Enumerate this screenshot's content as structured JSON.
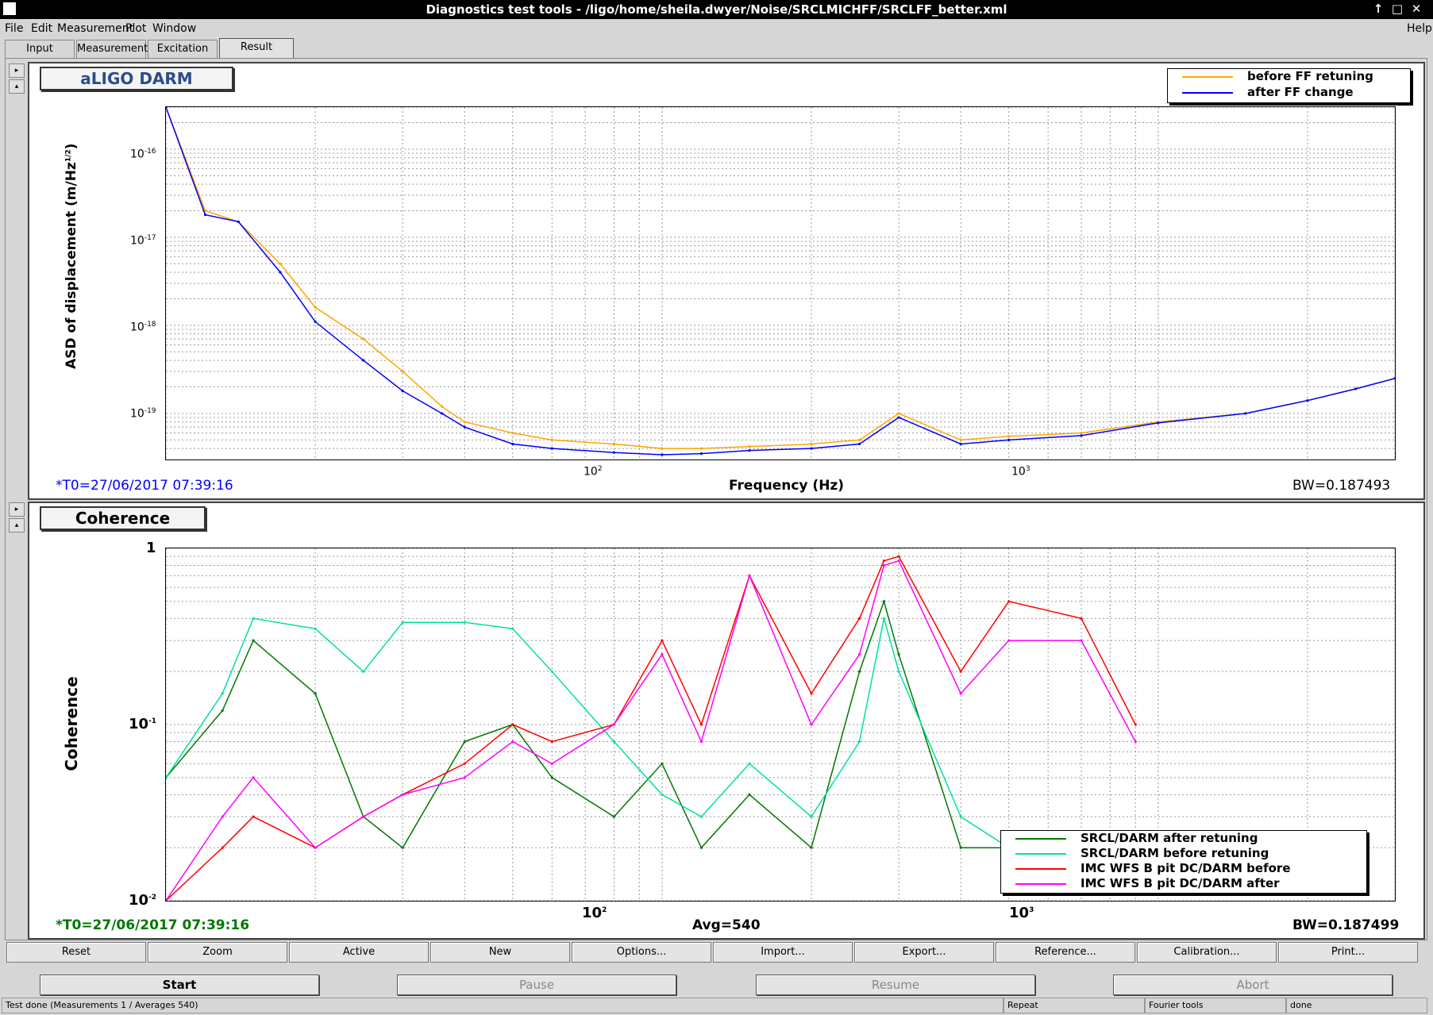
{
  "window": {
    "title": "Diagnostics test tools - /ligo/home/sheila.dwyer/Noise/SRCLMICHFF/SRCLFF_better.xml",
    "controls": [
      "↑",
      "□",
      "✕"
    ]
  },
  "menubar": {
    "items": [
      "File",
      "Edit",
      "Measurement",
      "Plot",
      "Window"
    ],
    "help": "Help"
  },
  "tabs": [
    {
      "label": "Input"
    },
    {
      "label": "Measurement"
    },
    {
      "label": "Excitation"
    },
    {
      "label": "Result"
    }
  ],
  "active_tab": "Result",
  "plot1": {
    "title": "aLIGO DARM",
    "ylabel": "ASD of displacement (m/Hz",
    "ylabel_sup": "1/2",
    "ylabel_close": ")",
    "xlabel": "Frequency (Hz)",
    "t0": "*T0=27/06/2017 07:39:16",
    "bw": "BW=0.187493",
    "y_ticks": [
      {
        "base": "10",
        "exp": "-16"
      },
      {
        "base": "10",
        "exp": "-17"
      },
      {
        "base": "10",
        "exp": "-18"
      },
      {
        "base": "10",
        "exp": "-19"
      }
    ],
    "x_ticks": [
      {
        "base": "10",
        "exp": "2"
      },
      {
        "base": "10",
        "exp": "3"
      }
    ],
    "legend": [
      {
        "label": "before FF retuning",
        "color": "#ffa500"
      },
      {
        "label": "after FF change",
        "color": "#0000ff"
      }
    ]
  },
  "plot2": {
    "title": "Coherence",
    "ylabel": "Coherence",
    "t0": "*T0=27/06/2017 07:39:16",
    "avg": "Avg=540",
    "bw": "BW=0.187499",
    "y_ticks": [
      {
        "base": "1",
        "exp": ""
      },
      {
        "base": "10",
        "exp": "-1"
      },
      {
        "base": "10",
        "exp": "-2"
      }
    ],
    "x_ticks": [
      {
        "base": "10",
        "exp": "2"
      },
      {
        "base": "10",
        "exp": "3"
      }
    ],
    "legend": [
      {
        "label": "SRCL/DARM after retuning",
        "color": "#007700"
      },
      {
        "label": "SRCL/DARM before retuning",
        "color": "#00e0a0"
      },
      {
        "label": "IMC WFS B pit DC/DARM before",
        "color": "#ff0000"
      },
      {
        "label": "IMC WFS B pit DC/DARM after",
        "color": "#ff00ff"
      }
    ]
  },
  "chart_data": [
    {
      "type": "line",
      "title": "aLIGO DARM",
      "xlabel": "Frequency (Hz)",
      "ylabel": "ASD of displacement (m/Hz^1/2)",
      "x_scale": "log",
      "y_scale": "log",
      "xlim": [
        10,
        3000
      ],
      "ylim": [
        3e-20,
        3e-16
      ],
      "grid": true,
      "legend_position": "top-right",
      "series": [
        {
          "name": "before FF retuning",
          "color": "#ffa500",
          "x": [
            10,
            12,
            14,
            17,
            20,
            25,
            30,
            36,
            40,
            50,
            60,
            80,
            100,
            120,
            150,
            200,
            250,
            300,
            400,
            500,
            700,
            1000,
            1500,
            2000,
            2500,
            3000
          ],
          "y": [
            3e-16,
            2e-17,
            1.5e-17,
            5e-18,
            1.6e-18,
            7e-19,
            3e-19,
            1.2e-19,
            8e-20,
            6e-20,
            5e-20,
            4.5e-20,
            4e-20,
            4e-20,
            4.2e-20,
            4.5e-20,
            5e-20,
            1e-19,
            5e-20,
            5.5e-20,
            6e-20,
            8e-20,
            1e-19,
            1.4e-19,
            1.9e-19,
            2.5e-19
          ]
        },
        {
          "name": "after FF change",
          "color": "#0000ff",
          "x": [
            10,
            12,
            14,
            17,
            20,
            25,
            30,
            36,
            40,
            50,
            60,
            80,
            100,
            120,
            150,
            200,
            250,
            300,
            400,
            500,
            700,
            1000,
            1500,
            2000,
            2500,
            3000
          ],
          "y": [
            3e-16,
            1.8e-17,
            1.5e-17,
            4e-18,
            1.1e-18,
            4e-19,
            1.8e-19,
            1e-19,
            7e-20,
            4.5e-20,
            4e-20,
            3.6e-20,
            3.4e-20,
            3.5e-20,
            3.8e-20,
            4e-20,
            4.5e-20,
            9e-20,
            4.5e-20,
            5e-20,
            5.6e-20,
            7.8e-20,
            1e-19,
            1.4e-19,
            1.9e-19,
            2.5e-19
          ]
        }
      ]
    },
    {
      "type": "line",
      "title": "Coherence",
      "ylabel": "Coherence",
      "x_scale": "log",
      "y_scale": "log",
      "xlim": [
        10,
        3000
      ],
      "ylim": [
        0.01,
        1
      ],
      "grid": true,
      "legend_position": "bottom-right",
      "series": [
        {
          "name": "SRCL/DARM after retuning",
          "color": "#007700",
          "x": [
            10,
            13,
            15,
            20,
            25,
            30,
            40,
            50,
            60,
            80,
            100,
            120,
            150,
            200,
            250,
            280,
            300,
            400,
            500,
            700,
            900
          ],
          "y": [
            0.05,
            0.12,
            0.3,
            0.15,
            0.03,
            0.02,
            0.08,
            0.1,
            0.05,
            0.03,
            0.06,
            0.02,
            0.04,
            0.02,
            0.2,
            0.5,
            0.25,
            0.02,
            0.02,
            0.02,
            0.015
          ]
        },
        {
          "name": "SRCL/DARM before retuning",
          "color": "#00e0a0",
          "x": [
            10,
            13,
            15,
            20,
            25,
            30,
            40,
            50,
            60,
            80,
            100,
            120,
            150,
            200,
            250,
            280,
            300,
            400,
            500,
            700,
            900
          ],
          "y": [
            0.05,
            0.15,
            0.4,
            0.35,
            0.2,
            0.38,
            0.38,
            0.35,
            0.2,
            0.08,
            0.04,
            0.03,
            0.06,
            0.03,
            0.08,
            0.4,
            0.2,
            0.03,
            0.02,
            0.02,
            0.015
          ]
        },
        {
          "name": "IMC WFS B pit DC/DARM before",
          "color": "#ff0000",
          "x": [
            10,
            13,
            15,
            20,
            25,
            30,
            40,
            50,
            60,
            80,
            100,
            120,
            150,
            200,
            250,
            280,
            300,
            400,
            500,
            700,
            900
          ],
          "y": [
            0.01,
            0.02,
            0.03,
            0.02,
            0.03,
            0.04,
            0.06,
            0.1,
            0.08,
            0.1,
            0.3,
            0.1,
            0.7,
            0.15,
            0.4,
            0.85,
            0.9,
            0.2,
            0.5,
            0.4,
            0.1
          ]
        },
        {
          "name": "IMC WFS B pit DC/DARM after",
          "color": "#ff00ff",
          "x": [
            10,
            13,
            15,
            20,
            25,
            30,
            40,
            50,
            60,
            80,
            100,
            120,
            150,
            200,
            250,
            280,
            300,
            400,
            500,
            700,
            900
          ],
          "y": [
            0.01,
            0.03,
            0.05,
            0.02,
            0.03,
            0.04,
            0.05,
            0.08,
            0.06,
            0.1,
            0.25,
            0.08,
            0.7,
            0.1,
            0.25,
            0.8,
            0.85,
            0.15,
            0.3,
            0.3,
            0.08
          ]
        }
      ]
    }
  ],
  "toolbar": [
    "Reset",
    "Zoom",
    "Active",
    "New",
    "Options...",
    "Import...",
    "Export...",
    "Reference...",
    "Calibration...",
    "Print..."
  ],
  "controls": {
    "start": "Start",
    "pause": "Pause",
    "resume": "Resume",
    "abort": "Abort"
  },
  "status": {
    "message": "Test done (Measurements 1 / Averages 540)",
    "mode": "Repeat",
    "tool": "Fourier tools",
    "state": "done"
  }
}
